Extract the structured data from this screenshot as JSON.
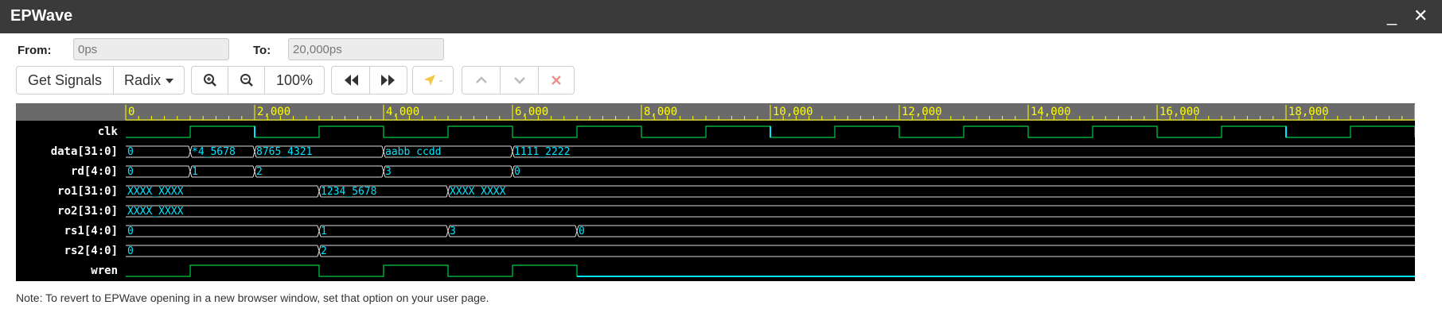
{
  "window": {
    "title": "EPWave",
    "minimize_glyph": "_",
    "close_glyph": "✕"
  },
  "range": {
    "from_label": "From:",
    "from_value": "0ps",
    "to_label": "To:",
    "to_value": "20,000ps"
  },
  "toolbar": {
    "get_signals": "Get Signals",
    "radix": "Radix",
    "zoom_level": "100%",
    "cursor_value": "-"
  },
  "icons": [
    "zoom-in-icon",
    "zoom-out-icon",
    "rewind-icon",
    "fast-forward-icon",
    "cursor-arrow-icon",
    "chevron-up-icon",
    "chevron-down-icon",
    "close-icon"
  ],
  "colors": {
    "title_bar": "#3a3a3a",
    "ruler_bg": "#6a6a6a",
    "ruler_text": "#ffff00",
    "wave_bg": "#000000",
    "signal_label": "#ffffff",
    "value_text": "#00e5ff",
    "clock_line": "#00cc44",
    "edge_marker": "#00e5ff",
    "bus_line": "#dddddd"
  },
  "timeline": {
    "start": 0,
    "end": 20000,
    "tick_labels": [
      "0",
      "2,000",
      "4,000",
      "6,000",
      "8,000",
      "10,000",
      "12,000",
      "14,000",
      "16,000",
      "18,000"
    ]
  },
  "signals": [
    {
      "name": "clk",
      "kind": "clock",
      "period": 2000,
      "high_first": false
    },
    {
      "name": "data[31:0]",
      "kind": "bus",
      "segments": [
        {
          "t": 0,
          "v": "0"
        },
        {
          "t": 1000,
          "v": "*4_5678"
        },
        {
          "t": 2000,
          "v": "8765_4321"
        },
        {
          "t": 4000,
          "v": "aabb_ccdd"
        },
        {
          "t": 6000,
          "v": "1111_2222"
        }
      ]
    },
    {
      "name": "rd[4:0]",
      "kind": "bus",
      "segments": [
        {
          "t": 0,
          "v": "0"
        },
        {
          "t": 1000,
          "v": "1"
        },
        {
          "t": 2000,
          "v": "2"
        },
        {
          "t": 4000,
          "v": "3"
        },
        {
          "t": 6000,
          "v": "0"
        }
      ]
    },
    {
      "name": "ro1[31:0]",
      "kind": "bus",
      "segments": [
        {
          "t": 0,
          "v": "XXXX_XXXX"
        },
        {
          "t": 3000,
          "v": "1234_5678"
        },
        {
          "t": 5000,
          "v": "XXXX_XXXX"
        }
      ]
    },
    {
      "name": "ro2[31:0]",
      "kind": "bus",
      "segments": [
        {
          "t": 0,
          "v": "XXXX_XXXX"
        }
      ]
    },
    {
      "name": "rs1[4:0]",
      "kind": "bus",
      "segments": [
        {
          "t": 0,
          "v": "0"
        },
        {
          "t": 3000,
          "v": "1"
        },
        {
          "t": 5000,
          "v": "3"
        },
        {
          "t": 7000,
          "v": "0"
        }
      ]
    },
    {
      "name": "rs2[4:0]",
      "kind": "bus",
      "segments": [
        {
          "t": 0,
          "v": "0"
        },
        {
          "t": 3000,
          "v": "2"
        }
      ]
    },
    {
      "name": "wren",
      "kind": "bit",
      "transitions": [
        {
          "t": 0,
          "v": 0
        },
        {
          "t": 1000,
          "v": 1
        },
        {
          "t": 3000,
          "v": 0
        },
        {
          "t": 4000,
          "v": 1
        },
        {
          "t": 5000,
          "v": 0
        },
        {
          "t": 6000,
          "v": 1
        },
        {
          "t": 7000,
          "v": 0
        }
      ]
    }
  ],
  "note": "Note: To revert to EPWave opening in a new browser window, set that option on your user page."
}
